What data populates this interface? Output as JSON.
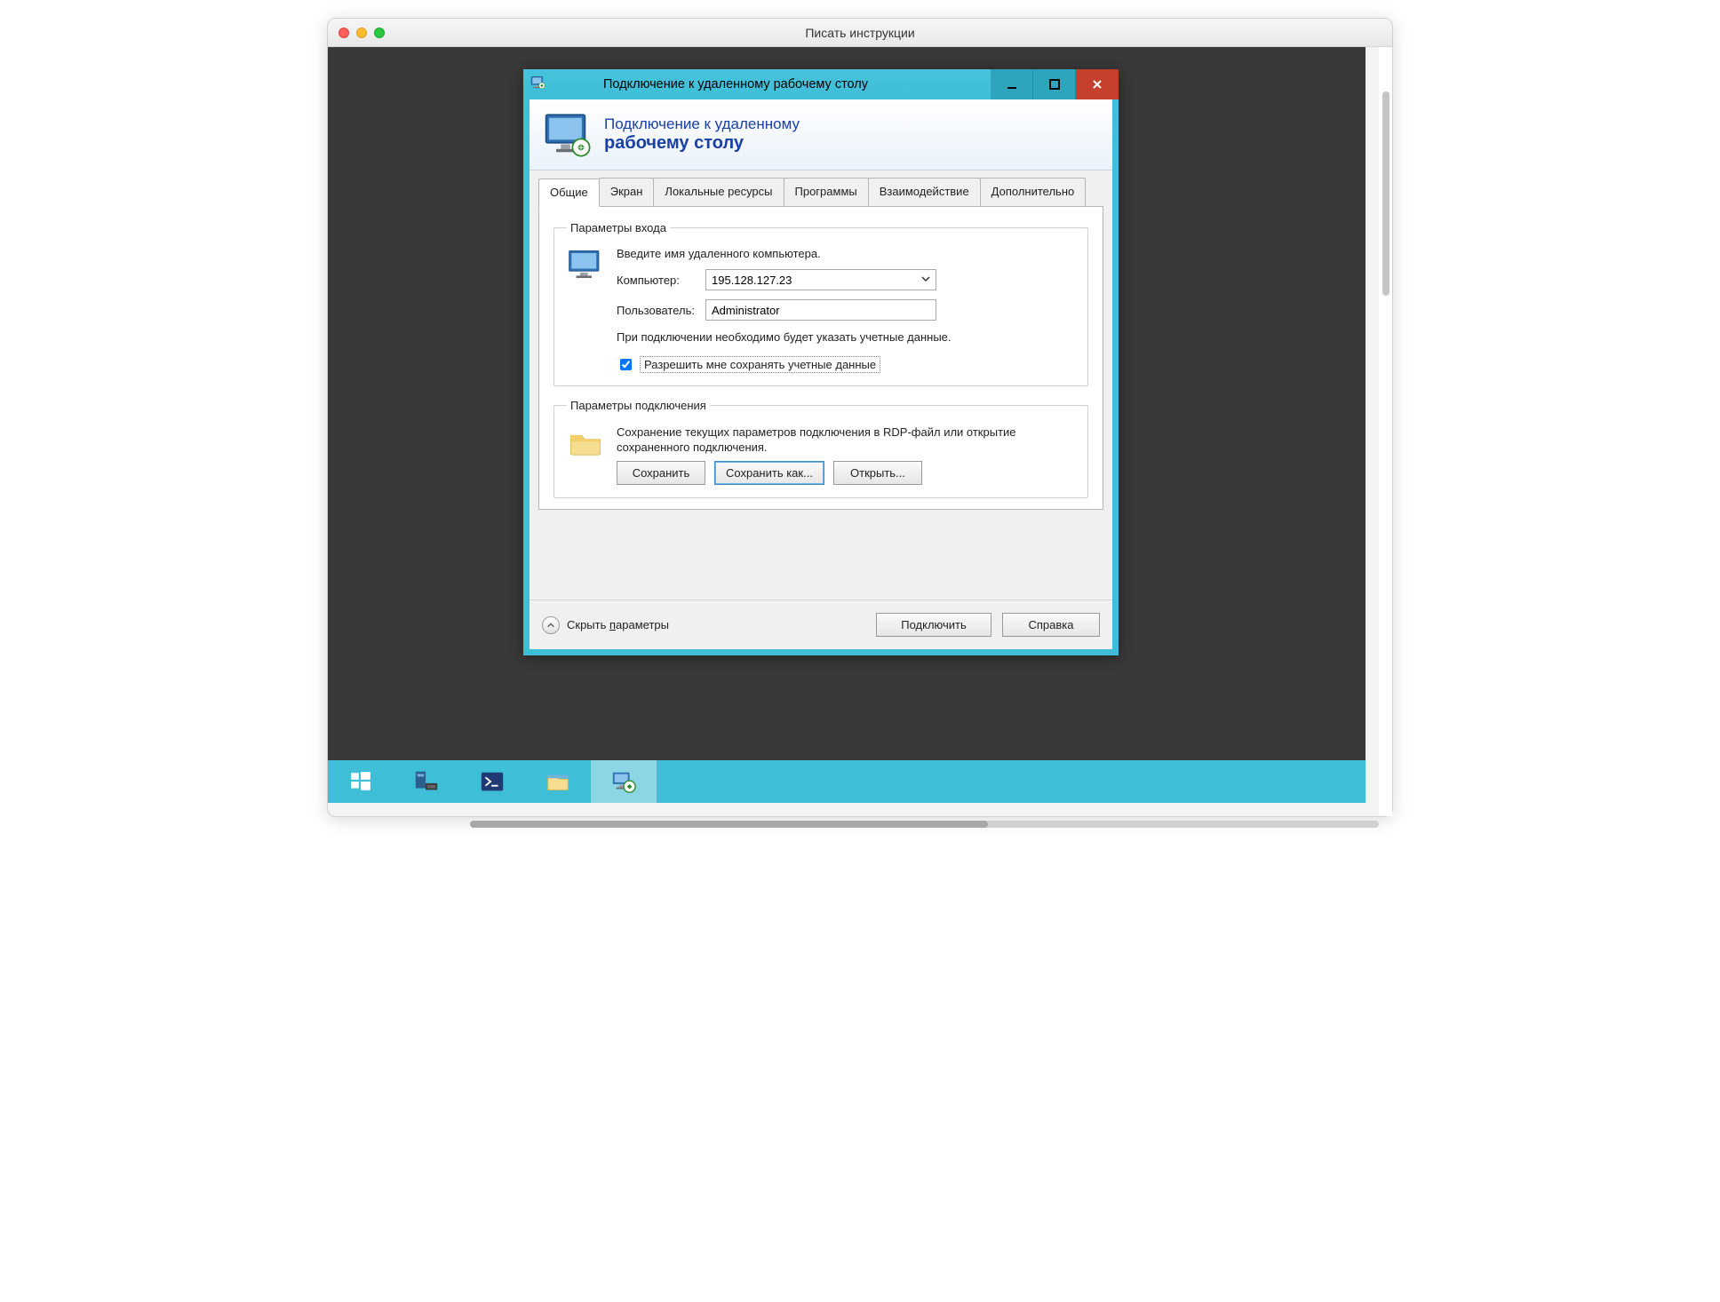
{
  "mac": {
    "title": "Писать инструкции"
  },
  "rdp": {
    "window_title": "Подключение к удаленному рабочему столу",
    "app_title_line1": "Подключение к удаленному",
    "app_title_line2": "рабочему столу",
    "tabs": {
      "general": "Общие",
      "display": "Экран",
      "local": "Локальные ресурсы",
      "programs": "Программы",
      "experience": "Взаимодействие",
      "advanced": "Дополнительно"
    },
    "logon": {
      "legend": "Параметры входа",
      "intro": "Введите имя удаленного компьютера.",
      "computer_label": "Компьютер:",
      "computer_value": "195.128.127.23",
      "user_label": "Пользователь:",
      "user_value": "Administrator",
      "note": "При подключении необходимо будет указать учетные данные.",
      "allow_save": "Разрешить мне сохранять учетные данные"
    },
    "conn": {
      "legend": "Параметры подключения",
      "text": "Сохранение текущих параметров подключения в RDP-файл или открытие сохраненного подключения.",
      "save": "Сохранить",
      "save_as": "Сохранить как...",
      "open": "Открыть..."
    },
    "footer": {
      "hide": "Скрыть параметры",
      "connect": "Подключить",
      "help": "Справка"
    }
  }
}
